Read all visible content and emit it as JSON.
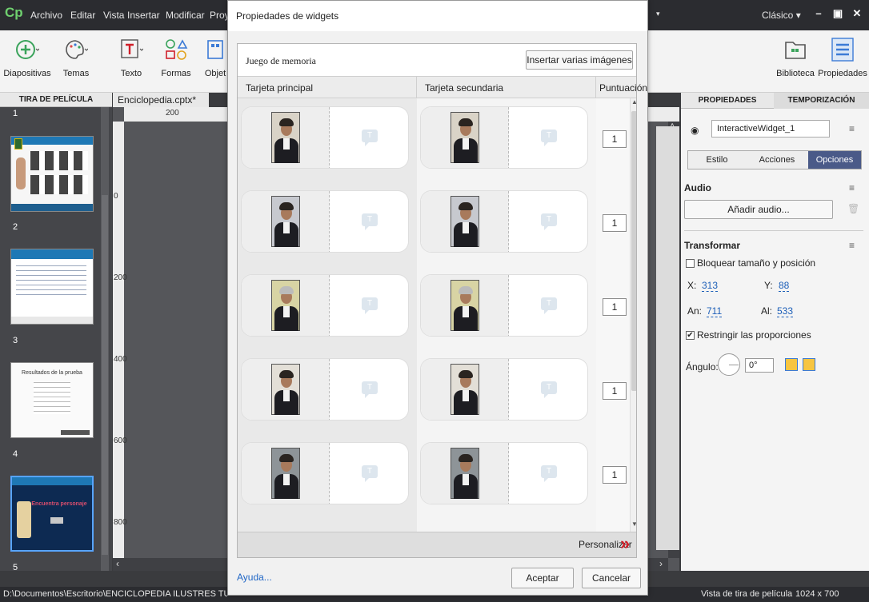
{
  "app": {
    "logo": "Cp",
    "menu": [
      "Archivo",
      "Editar",
      "Vista",
      "Insertar",
      "Modificar",
      "Proye"
    ],
    "mode": "Clásico",
    "mode_arrow": "▾"
  },
  "toolbar": {
    "items": [
      "Diapositivas",
      "Temas",
      "Texto",
      "Formas",
      "Objet"
    ],
    "right_items": [
      "Biblioteca",
      "Propiedades"
    ]
  },
  "filmstrip": {
    "title": "TIRA DE PELÍCULA",
    "slides": [
      "1",
      "2",
      "3",
      "4",
      "5"
    ],
    "slide3_title": "Resultados de la prueba",
    "slide4_title": "Encuentra personaje"
  },
  "document": {
    "tab": "Enciclopedia.cptx*",
    "tab_close": "×",
    "ruler_top": "200",
    "ruler_left": [
      "0",
      "200",
      "400",
      "600",
      "800"
    ]
  },
  "dialog": {
    "title": "Propiedades de widgets",
    "caption": "Juego de memoria",
    "insert_button": "Insertar varias imágenes",
    "columns": [
      "Tarjeta principal",
      "Tarjeta secundaria",
      "Puntuación"
    ],
    "rows": [
      {
        "score": "1"
      },
      {
        "score": "1"
      },
      {
        "score": "1"
      },
      {
        "score": "1"
      },
      {
        "score": "1"
      }
    ],
    "customize": "Personalizar",
    "help": "Ayuda...",
    "ok": "Aceptar",
    "cancel": "Cancelar"
  },
  "properties": {
    "tab_props": "PROPIEDADES",
    "tab_timing": "TEMPORIZACIÓN",
    "widget_name": "InteractiveWidget_1",
    "subtabs": [
      "Estilo",
      "Acciones",
      "Opciones"
    ],
    "audio_label": "Audio",
    "add_audio": "Añadir audio...",
    "transform_label": "Transformar",
    "lock_label": "Bloquear tamaño y posición",
    "x_label": "X:",
    "x_value": "313",
    "y_label": "Y:",
    "y_value": "88",
    "w_label": "An:",
    "w_value": "711",
    "h_label": "Al:",
    "h_value": "533",
    "constrain_label": "Restringir las proporciones",
    "angle_label": "Ángulo:",
    "angle_value": "0°"
  },
  "status": {
    "path": "D:\\Documentos\\Escritorio\\ENCICLOPEDIA ILUSTRES TUNGURAHUA",
    "view": "Vista de tira de película",
    "size": "1024 x 700"
  },
  "colors": {
    "menubar": "#2b2c30",
    "accent": "#1f66c6",
    "customize_arrow": "#d0202a",
    "active_subtab": "#4a5a88"
  }
}
